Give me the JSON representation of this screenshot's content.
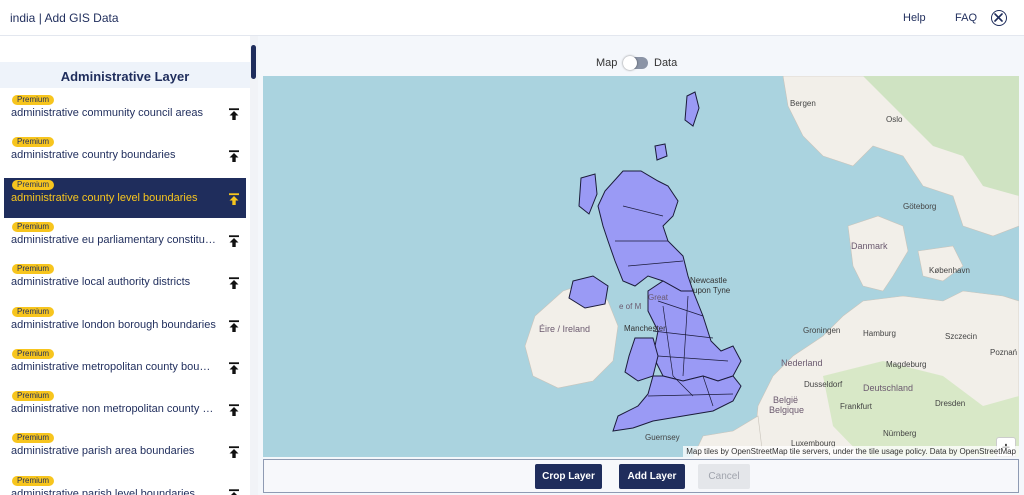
{
  "header": {
    "title": "india | Add GIS Data",
    "help": "Help",
    "faq": "FAQ"
  },
  "sidebar": {
    "title": "Administrative Layer",
    "badge": "Premium",
    "items": [
      {
        "label": "administrative community council areas",
        "active": false
      },
      {
        "label": "administrative country boundaries",
        "active": false
      },
      {
        "label": "administrative county level boundaries",
        "active": true
      },
      {
        "label": "administrative eu parliamentary constituencies",
        "active": false
      },
      {
        "label": "administrative local authority districts",
        "active": false
      },
      {
        "label": "administrative london borough boundaries",
        "active": false
      },
      {
        "label": "administrative metropolitan county boundaries",
        "active": false
      },
      {
        "label": "administrative non metropolitan county boundaries",
        "active": false
      },
      {
        "label": "administrative parish area boundaries",
        "active": false
      },
      {
        "label": "administrative parish level boundaries",
        "active": false
      }
    ]
  },
  "toggle": {
    "left": "Map",
    "right": "Data"
  },
  "map": {
    "labels": {
      "bergen": "Bergen",
      "oslo": "Oslo",
      "goteborg": "Göteborg",
      "danmark": "Danmark",
      "kobenhavn": "København",
      "newcastle": "Newcastle",
      "upon_tyne": "upon Tyne",
      "eire": "Éire / Ireland",
      "groningen": "Groningen",
      "hamburg": "Hamburg",
      "szczecin": "Szczecin",
      "poznan": "Poznań",
      "nederland": "Nederland",
      "magdeburg": "Magdeburg",
      "deutschland": "Deutschland",
      "dusseldorf": "Dusseldorf",
      "belgie": "België",
      "belgique": "Belgique",
      "frankfurt": "Frankfurt",
      "dresden": "Dresden",
      "nurnberg": "Nürnberg",
      "luxembourg": "Luxembourg",
      "guernsey": "Guernsey",
      "manchester": "Manchester",
      "great": "Great",
      "isle_of_man": "e of M"
    },
    "zoom_in": "+",
    "zoom_out": "−",
    "attribution": "Map tiles by OpenStreetMap tile servers, under the tile usage policy. Data by OpenStreetMap"
  },
  "actions": {
    "crop": "Crop Layer",
    "add": "Add Layer",
    "cancel": "Cancel"
  },
  "colors": {
    "brand": "#1f2d5c",
    "accent": "#f7c51e",
    "water": "#aad3df",
    "land": "#f2efe9",
    "region_fill": "#9a9af5"
  }
}
